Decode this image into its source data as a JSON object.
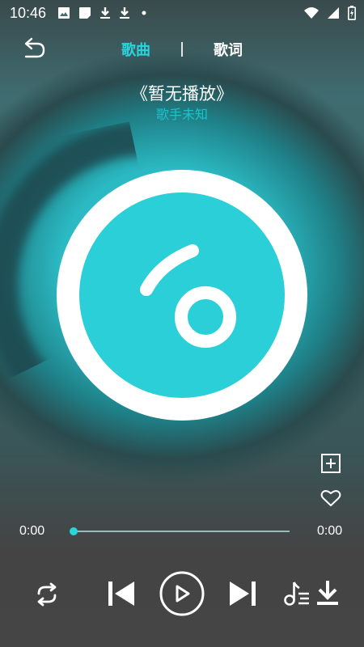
{
  "status": {
    "time": "10:46",
    "icons": [
      "image-icon",
      "note-icon",
      "download-icon",
      "download-icon",
      "dot-icon"
    ],
    "right_icons": [
      "wifi-icon",
      "signal-icon",
      "battery-charging-icon"
    ]
  },
  "tabs": {
    "song": "歌曲",
    "lyrics": "歌词",
    "active": "song"
  },
  "now_playing": {
    "title": "《暂无播放》",
    "artist": "歌手未知"
  },
  "progress": {
    "current": "0:00",
    "total": "0:00",
    "fraction": 0
  },
  "colors": {
    "accent": "#2ad4dc",
    "disc": "#2bcfd8"
  },
  "controls": [
    "repeat-icon",
    "previous-icon",
    "play-icon",
    "next-icon",
    "playlist-icon",
    "download-icon"
  ],
  "side_actions": [
    "add-to-playlist-icon",
    "favorite-icon"
  ]
}
